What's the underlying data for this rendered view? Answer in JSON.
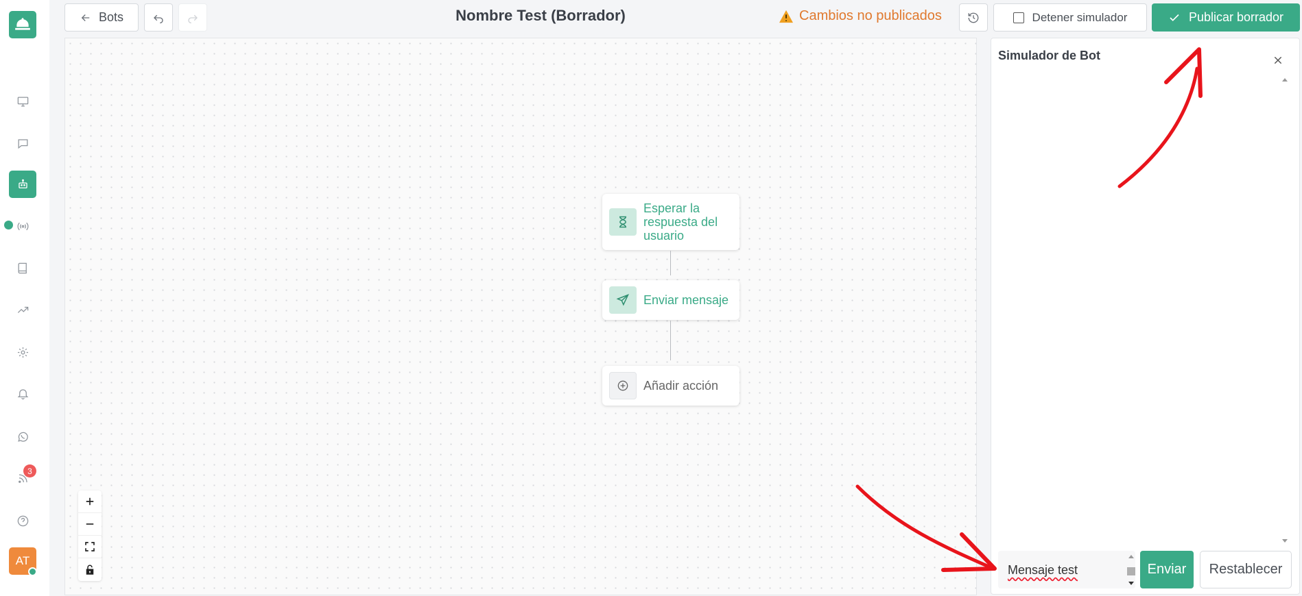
{
  "header": {
    "back_label": "Bots",
    "title": "Nombre Test (Borrador)",
    "unpublished_label": "Cambios no publicados",
    "stop_simulator_label": "Detener simulador",
    "publish_label": "Publicar borrador"
  },
  "sidebar": {
    "items": [
      {
        "name": "monitor-icon"
      },
      {
        "name": "chat-icon"
      },
      {
        "name": "bot-icon",
        "active": true
      },
      {
        "name": "broadcast-icon"
      },
      {
        "name": "book-icon"
      },
      {
        "name": "trending-icon"
      },
      {
        "name": "gear-icon"
      },
      {
        "name": "bell-icon"
      },
      {
        "name": "whatsapp-icon"
      },
      {
        "name": "rss-icon"
      },
      {
        "name": "help-icon"
      }
    ],
    "notification_count": "3",
    "avatar_initials": "AT"
  },
  "canvas": {
    "nodes": [
      {
        "label": "Esperar la respuesta del usuario",
        "icon": "hourglass-icon"
      },
      {
        "label": "Enviar mensaje",
        "icon": "send-icon"
      },
      {
        "label": "Añadir acción",
        "icon": "plus-circle-icon"
      }
    ]
  },
  "simulator": {
    "title": "Simulador de Bot",
    "input_value": "Mensaje test",
    "send_label": "Enviar",
    "reset_label": "Restablecer"
  },
  "colors": {
    "accent": "#3aaa87",
    "warning": "#e0792e",
    "annotation": "#e8141b",
    "badge": "#ee5a5a",
    "avatar": "#ef8a3c"
  }
}
